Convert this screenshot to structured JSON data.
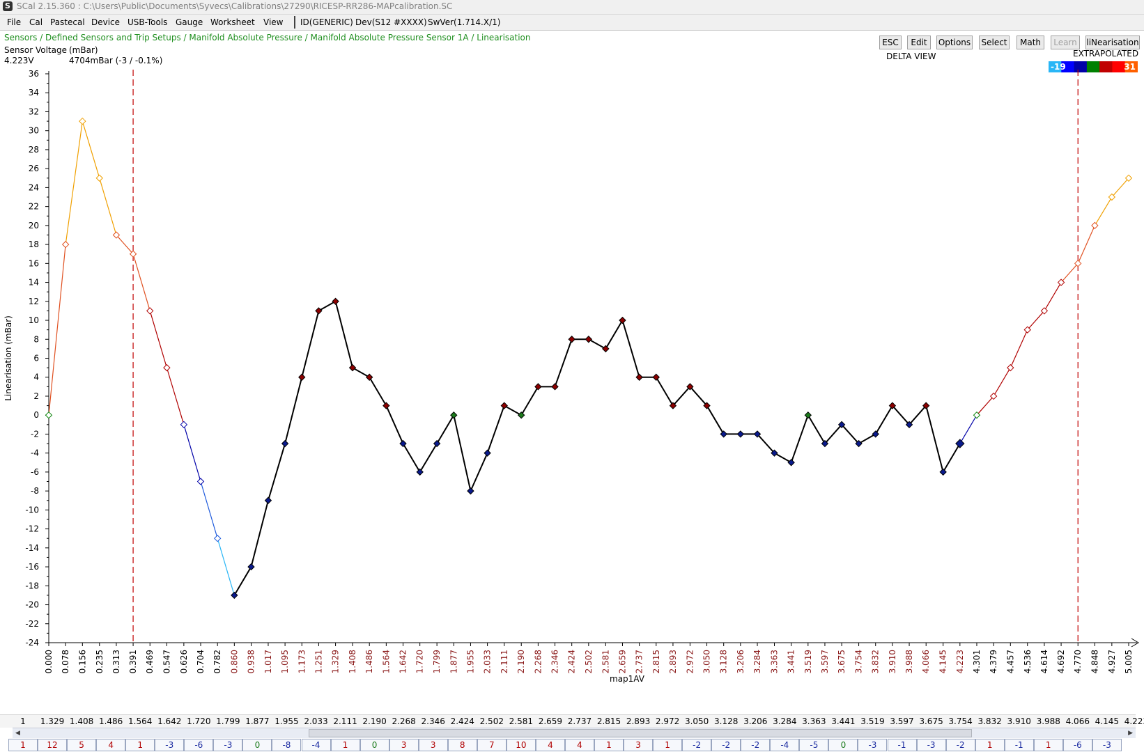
{
  "window": {
    "title": "SCal 2.15.360  :  C:\\Users\\Public\\Documents\\Syvecs\\Calibrations\\27290\\RICESP-RR286-MAPcalibration.SC"
  },
  "menu": [
    "File",
    "Cal",
    "Pastecal",
    "Device",
    "USB-Tools",
    "Gauge",
    "Worksheet",
    "View"
  ],
  "status": {
    "id": "ID(GENERIC)",
    "dev": "Dev(S12 #XXXX)",
    "swver": "SwVer(1.714.X/1)"
  },
  "breadcrumb": "Sensors / Defined Sensors and Trip Setups / Manifold Absolute Pressure / Manifold Absolute Pressure Sensor 1A / Linearisation",
  "sensor": {
    "label": "Sensor Voltage",
    "unit": "(mBar)",
    "voltage": "4.223V",
    "reading": "4704mBar (-3 / -0.1%)"
  },
  "toolbar": [
    "ESC",
    "Edit",
    "Options",
    "Select",
    "Math",
    "Learn",
    "liNearisation"
  ],
  "toolbar_disabled": [
    "Learn"
  ],
  "view_mode": "DELTA VIEW",
  "extrapolated_label": "EXTRAPOLATED",
  "colorscale": {
    "min": "-19",
    "max": "31",
    "colors": [
      "#29b6f6",
      "#0000ff",
      "#0000a8",
      "#008000",
      "#c00000",
      "#ff0000",
      "#ff6000"
    ]
  },
  "colors": {
    "line": "#000000",
    "marker_negative": "#0a1a8c",
    "marker_positive": "#8b0000",
    "marker_zero": "#1b7a1b",
    "tick_red": "#8b1a1a",
    "boundary": "#c00000"
  },
  "chart_data": {
    "type": "line",
    "xlabel": "map1AV",
    "ylabel": "Linearisation (mBar)",
    "ylim": [
      -24,
      36
    ],
    "yticks": [
      -24,
      -22,
      -20,
      -18,
      -16,
      -14,
      -12,
      -10,
      -8,
      -6,
      -4,
      -2,
      0,
      2,
      4,
      6,
      8,
      10,
      12,
      14,
      16,
      18,
      20,
      22,
      24,
      26,
      28,
      30,
      32,
      34,
      36
    ],
    "x": [
      "0.000",
      "0.078",
      "0.156",
      "0.235",
      "0.313",
      "0.391",
      "0.469",
      "0.547",
      "0.626",
      "0.704",
      "0.782",
      "0.860",
      "0.938",
      "1.017",
      "1.095",
      "1.173",
      "1.251",
      "1.329",
      "1.408",
      "1.486",
      "1.564",
      "1.642",
      "1.720",
      "1.799",
      "1.877",
      "1.955",
      "2.033",
      "2.111",
      "2.190",
      "2.268",
      "2.346",
      "2.424",
      "2.502",
      "2.581",
      "2.659",
      "2.737",
      "2.815",
      "2.893",
      "2.972",
      "3.050",
      "3.128",
      "3.206",
      "3.284",
      "3.363",
      "3.441",
      "3.519",
      "3.597",
      "3.675",
      "3.754",
      "3.832",
      "3.910",
      "3.988",
      "4.066",
      "4.145",
      "4.223",
      "4.301",
      "4.379",
      "4.457",
      "4.536",
      "4.614",
      "4.692",
      "4.770",
      "4.848",
      "4.927",
      "5.005"
    ],
    "values": [
      0,
      18,
      31,
      25,
      19,
      17,
      11,
      5,
      -1,
      -7,
      -13,
      -19,
      -16,
      -9,
      -3,
      4,
      11,
      12,
      5,
      4,
      1,
      -3,
      -6,
      -3,
      0,
      -8,
      -4,
      1,
      0,
      3,
      3,
      8,
      8,
      7,
      10,
      4,
      4,
      1,
      3,
      1,
      -2,
      -2,
      -2,
      -4,
      -5,
      0,
      -3,
      -1,
      -3,
      -2,
      1,
      -1,
      1,
      -6,
      -3,
      0,
      2,
      5,
      9,
      11,
      14,
      16,
      20,
      23,
      25
    ],
    "active_range": [
      0.86,
      4.223
    ],
    "boundaries": [
      0.391,
      4.77
    ]
  },
  "x_strip": [
    "1",
    "1.329",
    "1.408",
    "1.486",
    "1.564",
    "1.642",
    "1.720",
    "1.799",
    "1.877",
    "1.955",
    "2.033",
    "2.111",
    "2.190",
    "2.268",
    "2.346",
    "2.424",
    "2.502",
    "2.581",
    "2.659",
    "2.737",
    "2.815",
    "2.893",
    "2.972",
    "3.050",
    "3.128",
    "3.206",
    "3.284",
    "3.363",
    "3.441",
    "3.519",
    "3.597",
    "3.675",
    "3.754",
    "3.832",
    "3.910",
    "3.988",
    "4.066",
    "4.145",
    "4.223"
  ],
  "delta_strip": [
    "1",
    "12",
    "5",
    "4",
    "1",
    "-3",
    "-6",
    "-3",
    "0",
    "-8",
    "-4",
    "1",
    "0",
    "3",
    "3",
    "8",
    "7",
    "10",
    "4",
    "4",
    "1",
    "3",
    "1",
    "-2",
    "-2",
    "-2",
    "-4",
    "-5",
    "0",
    "-3",
    "-1",
    "-3",
    "-2",
    "1",
    "-1",
    "1",
    "-6",
    "-3"
  ]
}
